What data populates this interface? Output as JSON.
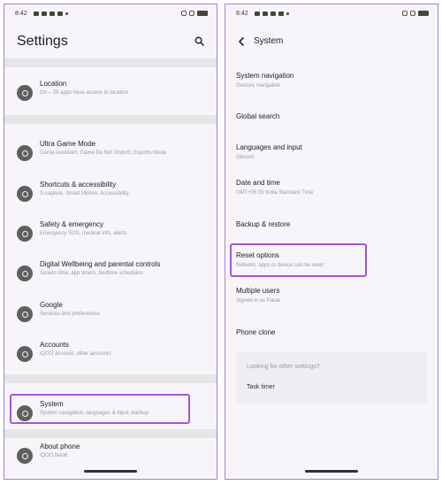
{
  "left": {
    "status_time": "8:42",
    "title": "Settings",
    "items": [
      {
        "label": "Location",
        "sub": "On – 29 apps have access to location",
        "icon": "location-icon"
      },
      {
        "label": "Ultra Game Mode",
        "sub": "Game Assistant, Game Do Not Disturb, Esports Mode",
        "icon": "gamepad-icon"
      },
      {
        "label": "Shortcuts & accessibility",
        "sub": "S-capture, Smart Motion, Accessibility",
        "icon": "shortcuts-icon"
      },
      {
        "label": "Safety & emergency",
        "sub": "Emergency SOS, medical info, alerts",
        "icon": "safety-icon"
      },
      {
        "label": "Digital Wellbeing and parental controls",
        "sub": "Screen time, app timers, bedtime schedules",
        "icon": "wellbeing-icon"
      },
      {
        "label": "Google",
        "sub": "Services and preferences",
        "icon": "google-icon"
      },
      {
        "label": "Accounts",
        "sub": "iQOO account, other accounts",
        "icon": "accounts-icon"
      },
      {
        "label": "System",
        "sub": "System navigation, languages & input, backup",
        "icon": "system-icon"
      },
      {
        "label": "About phone",
        "sub": "iQOO Neo6",
        "icon": "about-phone-icon"
      }
    ]
  },
  "right": {
    "status_time": "8:42",
    "title": "System",
    "items": [
      {
        "label": "System navigation",
        "sub": "Gesture navigation"
      },
      {
        "label": "Global search",
        "sub": ""
      },
      {
        "label": "Languages and input",
        "sub": "Gboard"
      },
      {
        "label": "Date and time",
        "sub": "GMT+05:30 India Standard Time"
      },
      {
        "label": "Backup & restore",
        "sub": ""
      },
      {
        "label": "Reset options",
        "sub": "Network, apps or device can be reset"
      },
      {
        "label": "Multiple users",
        "sub": "Signed in as Paras"
      },
      {
        "label": "Phone clone",
        "sub": ""
      }
    ],
    "other_settings": {
      "question": "Looking for other settings?",
      "link": "Task timer"
    }
  },
  "colors": {
    "highlight": "#a257d6",
    "frame": "#a77fd6",
    "background": "#f8f5fa"
  }
}
